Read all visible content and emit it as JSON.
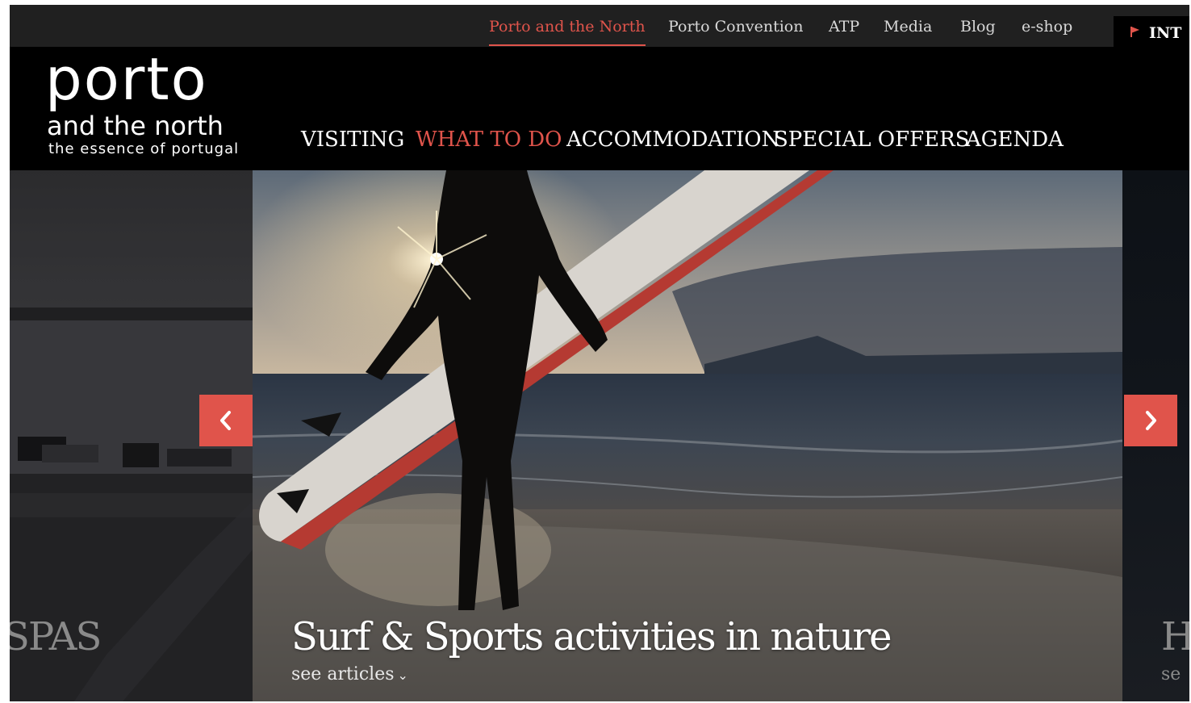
{
  "top_bar": {
    "links": [
      {
        "label": "Porto and the North",
        "active": true
      },
      {
        "label": "Porto Convention",
        "active": false
      },
      {
        "label": "ATP",
        "active": false
      },
      {
        "label": "Media",
        "active": false
      },
      {
        "label": "Blog",
        "active": false
      },
      {
        "label": "e-shop",
        "active": false
      }
    ],
    "language": "INT"
  },
  "logo": {
    "main": "porto",
    "sub": "and the north",
    "tagline": "the essence of portugal"
  },
  "main_nav": [
    {
      "label": "VISITING",
      "active": false
    },
    {
      "label": "WHAT TO DO",
      "active": true
    },
    {
      "label": "ACCOMMODATION",
      "active": false
    },
    {
      "label": "SPECIAL OFFERS",
      "active": false
    },
    {
      "label": "AGENDA",
      "active": false
    }
  ],
  "carousel": {
    "prev_slide_caption": "SPAS",
    "main_slide_caption": "Surf & Sports activities in nature",
    "main_slide_link": "see articles",
    "next_slide_caption": "H",
    "next_slide_link": "se"
  },
  "colors": {
    "accent": "#e0544b",
    "topbar_bg": "#202020",
    "header_bg": "#000000"
  }
}
